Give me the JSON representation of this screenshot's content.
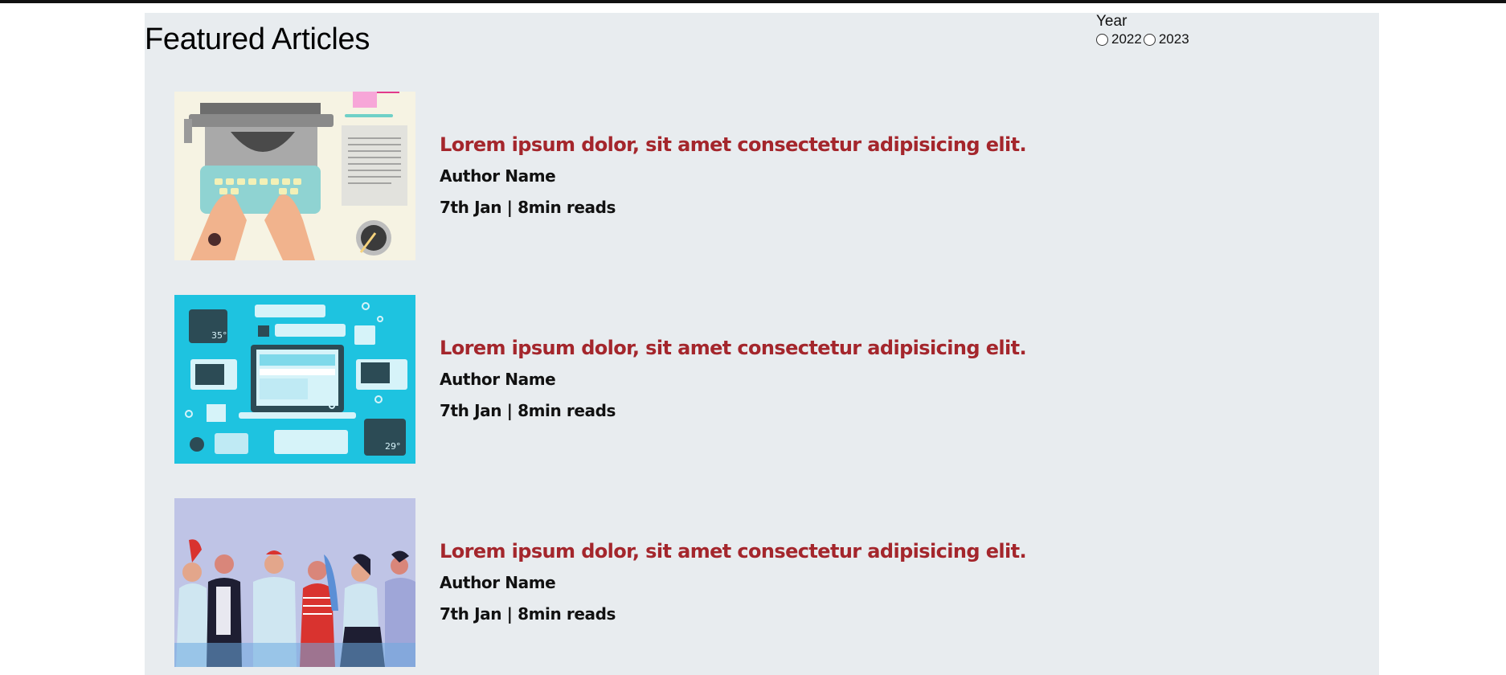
{
  "page": {
    "title": "Featured Articles"
  },
  "filter": {
    "label": "Year",
    "options": [
      "2022",
      "2023"
    ]
  },
  "articles": [
    {
      "title": "Lorem ipsum dolor, sit amet consectetur adipisicing elit.",
      "author": "Author Name",
      "date": "7th Jan | 8min reads",
      "image_icon": "typewriter-illustration",
      "weather_1": "",
      "weather_2": ""
    },
    {
      "title": "Lorem ipsum dolor, sit amet consectetur adipisicing elit.",
      "author": "Author Name",
      "date": "7th Jan | 8min reads",
      "image_icon": "laptop-widgets-illustration",
      "weather_1": "35°",
      "weather_2": "29°"
    },
    {
      "title": "Lorem ipsum dolor, sit amet consectetur adipisicing elit.",
      "author": "Author Name",
      "date": "7th Jan | 8min reads",
      "image_icon": "crowd-people-illustration",
      "weather_1": "",
      "weather_2": ""
    }
  ],
  "colors": {
    "panel_bg": "#e8ecef",
    "title_accent": "#a4262c",
    "thumb2_bg": "#1ec3e0",
    "thumb3_bg": "#bfc4e6"
  }
}
